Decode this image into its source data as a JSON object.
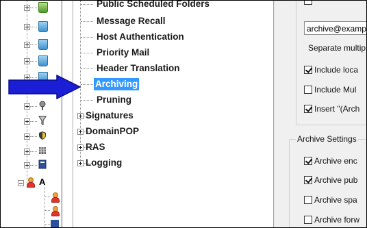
{
  "tree": {
    "items": [
      {
        "label": "Public Scheduled Folders",
        "expander": false
      },
      {
        "label": "Message Recall",
        "expander": false
      },
      {
        "label": "Host Authentication",
        "expander": false
      },
      {
        "label": "Priority Mail",
        "expander": false
      },
      {
        "label": "Header Translation",
        "expander": false
      },
      {
        "label": "Archiving",
        "expander": false,
        "selected": true
      },
      {
        "label": "Pruning",
        "expander": false
      },
      {
        "label": "Signatures",
        "expander": true
      },
      {
        "label": "DomainPOP",
        "expander": true
      },
      {
        "label": "RAS",
        "expander": true
      },
      {
        "label": "Logging",
        "expander": true
      }
    ]
  },
  "left_panel": {
    "account_letter": "A"
  },
  "settings": {
    "email_value": "archive@examp",
    "separate_text": "Separate multip",
    "checkbox_top_partial": "",
    "checkboxes_group1": [
      {
        "label": "Include loca",
        "checked": true
      },
      {
        "label": "Include Mul",
        "checked": false
      },
      {
        "label": "Insert \"(Arch",
        "checked": true
      }
    ],
    "archive_settings_legend": "Archive Settings",
    "checkboxes_group2": [
      {
        "label": "Archive enc",
        "checked": true
      },
      {
        "label": "Archive pub",
        "checked": true
      },
      {
        "label": "Archive spa",
        "checked": false
      },
      {
        "label": "Archive forw",
        "checked": false
      }
    ]
  },
  "colors": {
    "selection": "#3399ff",
    "arrow": "#1a1fd6"
  },
  "icons": {
    "pointer_arrow": "arrow-right-icon"
  }
}
